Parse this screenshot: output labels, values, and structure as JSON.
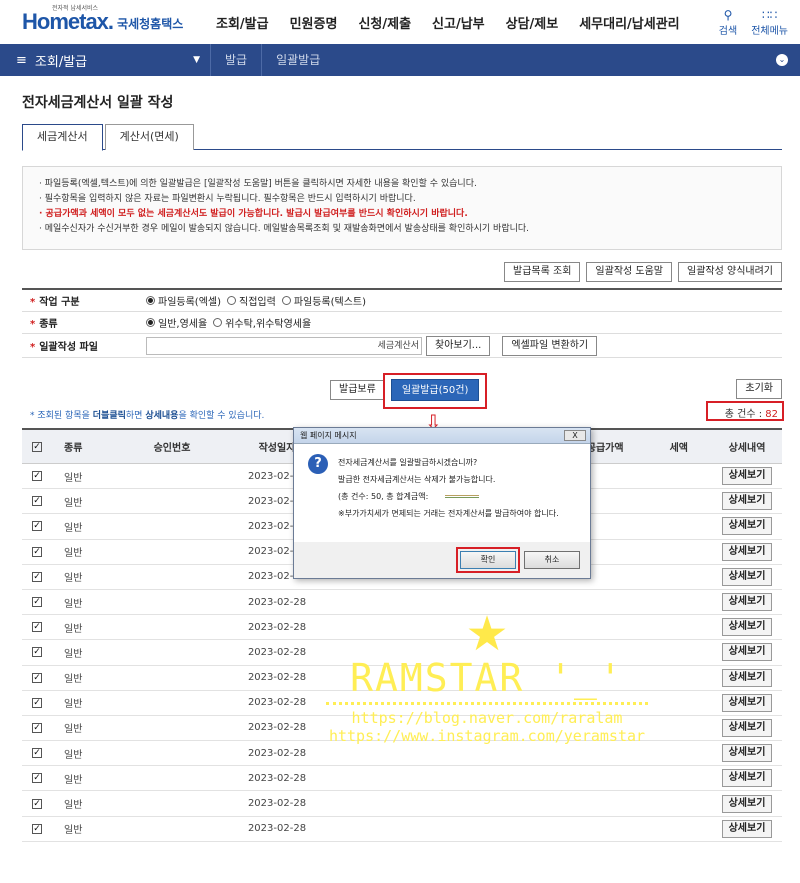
{
  "header": {
    "logo_tiny": "전자적 납세서비스",
    "logo_main": "Hometax.",
    "logo_sub": "국세청홈택스",
    "menu": [
      "조회/발급",
      "민원증명",
      "신청/제출",
      "신고/납부",
      "상담/제보",
      "세무대리/납세관리"
    ],
    "search_label": "검색",
    "allmenu_label": "전체메뉴"
  },
  "navbar": {
    "current": "조회/발급",
    "crumbs": [
      "발급",
      "일괄발급"
    ]
  },
  "page": {
    "title": "전자세금계산서 일괄 작성",
    "tabs": [
      "세금계산서",
      "계산서(면세)"
    ]
  },
  "notice": {
    "line1": "· 파일등록(엑셀,텍스트)에 의한 일괄발급은 [일괄작성 도움말] 버튼을 클릭하시면 자세한 내용을 확인할 수 있습니다.",
    "line2": "· 필수항목을 입력하지 않은 자료는 파일변환시 누락됩니다. 필수항목은 반드시 입력하시기 바랍니다.",
    "line3": "· 공급가액과 세액이 모두 없는 세금계산서도 발급이 가능합니다. 발급시 발급여부를 반드시 확인하시기 바랍니다.",
    "line4": "· 메일수신자가 수신거부한 경우 메일이 발송되지 않습니다. 메일발송목록조회 및 재발송화면에서 발송상태를 확인하시기 바랍니다."
  },
  "toolbar": {
    "list_button": "발급목록 조회",
    "help_button": "일괄작성 도움말",
    "template_button": "일괄작성 양식내려기"
  },
  "form": {
    "work_label": "작업 구분",
    "work_options": [
      "파일등록(엑셀)",
      "직접입력",
      "파일등록(텍스트)"
    ],
    "type_label": "종류",
    "type_options": [
      "일반,영세율",
      "위수탁,위수탁영세율"
    ],
    "file_label": "일괄작성 파일",
    "file_value": "세금계산서 ",
    "browse_button": "찾아보기...",
    "convert_button": "엑셀파일 변환하기"
  },
  "actions": {
    "hold_button": "발급보류",
    "issue_button": "일괄발급(50건)",
    "reset_button": "초기화",
    "hint_prefix": "* 조회된 항목을 ",
    "hint_bold1": "더블클릭",
    "hint_mid": "하면 ",
    "hint_bold2": "상세내용",
    "hint_suffix": "을 확인할 수 있습니다.",
    "total_label": "총 건수 : ",
    "total_value": "82"
  },
  "grid": {
    "headers": {
      "type": "종류",
      "approval": "승인번호",
      "date": "작성일자",
      "supply": "공급가액",
      "tax": "세액",
      "detail": "상세내역"
    },
    "rows": [
      {
        "type": "일반",
        "date": "2023-02-28"
      },
      {
        "type": "일반",
        "date": "2023-02-28"
      },
      {
        "type": "일반",
        "date": "2023-02-28"
      },
      {
        "type": "일반",
        "date": "2023-02-28"
      },
      {
        "type": "일반",
        "date": "2023-02-28"
      },
      {
        "type": "일반",
        "date": "2023-02-28"
      },
      {
        "type": "일반",
        "date": "2023-02-28"
      },
      {
        "type": "일반",
        "date": "2023-02-28"
      },
      {
        "type": "일반",
        "date": "2023-02-28"
      },
      {
        "type": "일반",
        "date": "2023-02-28"
      },
      {
        "type": "일반",
        "date": "2023-02-28"
      },
      {
        "type": "일반",
        "date": "2023-02-28"
      },
      {
        "type": "일반",
        "date": "2023-02-28"
      },
      {
        "type": "일반",
        "date": "2023-02-28"
      },
      {
        "type": "일반",
        "date": "2023-02-28"
      }
    ],
    "detail_button": "상세보기"
  },
  "dialog": {
    "title": "웹 페이지 메시지",
    "line1": "전자세금계산서를 일괄발급하시겠습니까?",
    "line2": "발급한 전자세금계산서는 삭제가 불가능합니다.",
    "line3": "(총 건수: 50, 총 합계금액:",
    "line4": "※부가가치세가 면제되는 거래는 전자계산서를 발급하여야 합니다.",
    "ok": "확인",
    "cancel": "취소",
    "close": "X"
  },
  "watermark": {
    "main": "RAMSTAR '_'",
    "url1": "https://blog.naver.com/raralam",
    "url2": "https://www.instagram.com/yeramstar"
  }
}
